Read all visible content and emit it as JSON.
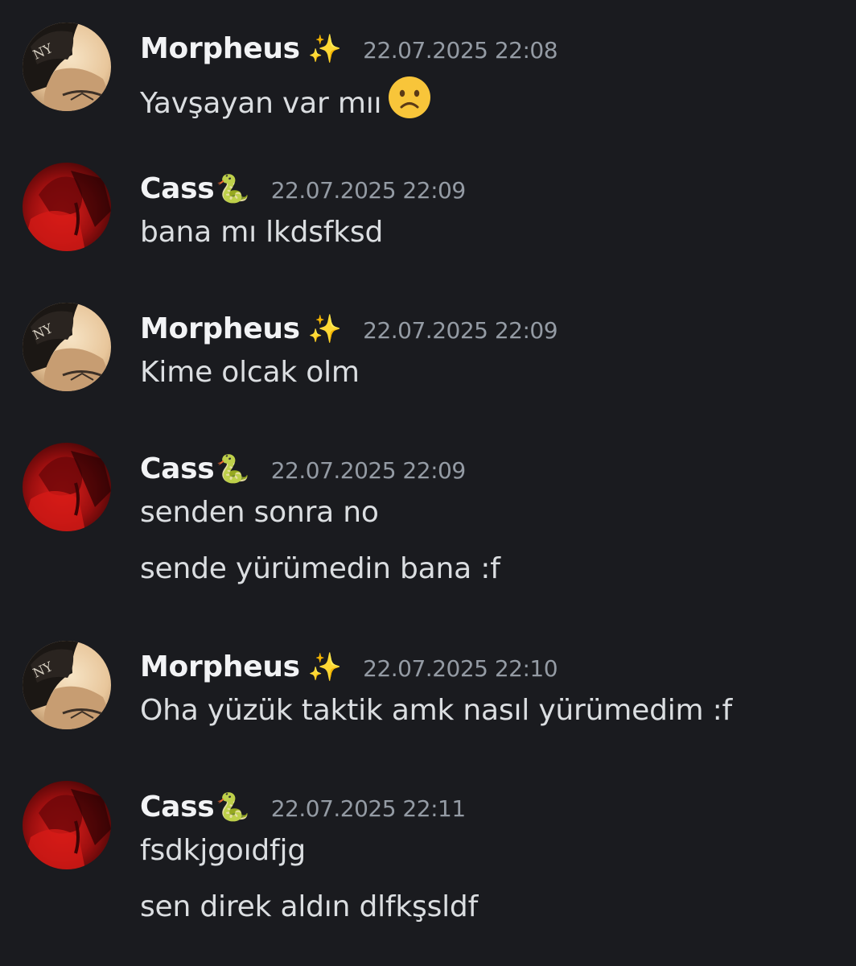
{
  "messages": [
    {
      "author": "Morpheus",
      "badge": "✨",
      "timestamp": "22.07.2025 22:08",
      "lines": [
        "Yavşayan var mıı"
      ],
      "trailing_emoji": "frowning-face-emoji"
    },
    {
      "author": "Cass",
      "badge": "🐍",
      "timestamp": "22.07.2025 22:09",
      "lines": [
        "bana mı lkdsfksd"
      ]
    },
    {
      "author": "Morpheus",
      "badge": "✨",
      "timestamp": "22.07.2025 22:09",
      "lines": [
        "Kime olcak olm"
      ]
    },
    {
      "author": "Cass",
      "badge": "🐍",
      "timestamp": "22.07.2025 22:09",
      "lines": [
        "senden sonra no",
        "sende yürümedin bana :f"
      ]
    },
    {
      "author": "Morpheus",
      "badge": "✨",
      "timestamp": "22.07.2025 22:10",
      "lines": [
        "Oha yüzük taktik  amk nasıl yürümedim :f"
      ]
    },
    {
      "author": "Cass",
      "badge": "🐍",
      "timestamp": "22.07.2025 22:11",
      "lines": [
        "fsdkjgoıdfjg",
        "sen direk aldın dlfkşsldf"
      ]
    }
  ],
  "colors": {
    "background": "#1a1b1f",
    "username": "#f2f3f5",
    "timestamp": "#949ba4",
    "message_text": "#dbdee1"
  }
}
